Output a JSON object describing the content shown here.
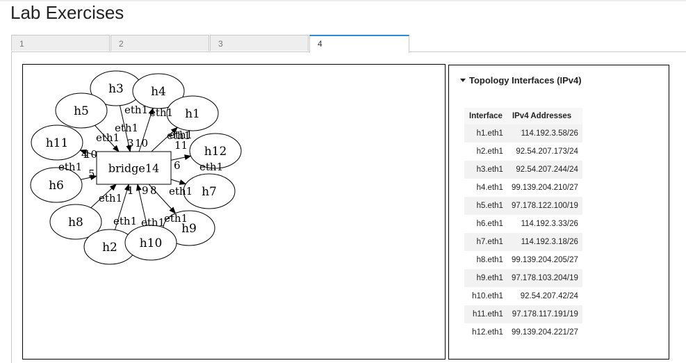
{
  "page": {
    "title": "Lab Exercises"
  },
  "tabs": [
    {
      "label": "1",
      "active": false
    },
    {
      "label": "2",
      "active": false
    },
    {
      "label": "3",
      "active": false
    },
    {
      "label": "4",
      "active": true
    }
  ],
  "interfaces_panel": {
    "heading": "Topology Interfaces (IPv4)",
    "columns": [
      "Interface",
      "IPv4 Addresses"
    ],
    "rows": [
      [
        "h1.eth1",
        "114.192.3.58/26"
      ],
      [
        "h2.eth1",
        "92.54.207.173/24"
      ],
      [
        "h3.eth1",
        "92.54.207.244/24"
      ],
      [
        "h4.eth1",
        "99.139.204.210/27"
      ],
      [
        "h5.eth1",
        "97.178.122.100/19"
      ],
      [
        "h6.eth1",
        "114.192.3.33/26"
      ],
      [
        "h7.eth1",
        "114.192.3.18/26"
      ],
      [
        "h8.eth1",
        "99.139.204.205/27"
      ],
      [
        "h9.eth1",
        "97.178.103.204/19"
      ],
      [
        "h10.eth1",
        "92.54.207.42/24"
      ],
      [
        "h11.eth1",
        "97.178.117.191/19"
      ],
      [
        "h12.eth1",
        "99.139.204.221/27"
      ]
    ]
  },
  "topology": {
    "switch": "bridge14",
    "hosts": [
      "h3",
      "h4",
      "h5",
      "h1",
      "h11",
      "h12",
      "h6",
      "h7",
      "h8",
      "h9",
      "h2",
      "h10"
    ],
    "edge_labels": [
      "eth1",
      "eth1",
      "eth1",
      "eth1",
      "eth1",
      "eth1",
      "eth1",
      "eth1",
      "eth1",
      "eth1",
      "eth1",
      "eth1",
      "eth1"
    ],
    "port_labels": [
      "3",
      "10",
      "4",
      "11",
      "10",
      "6",
      "5",
      "1",
      "1",
      "9",
      "8"
    ]
  }
}
